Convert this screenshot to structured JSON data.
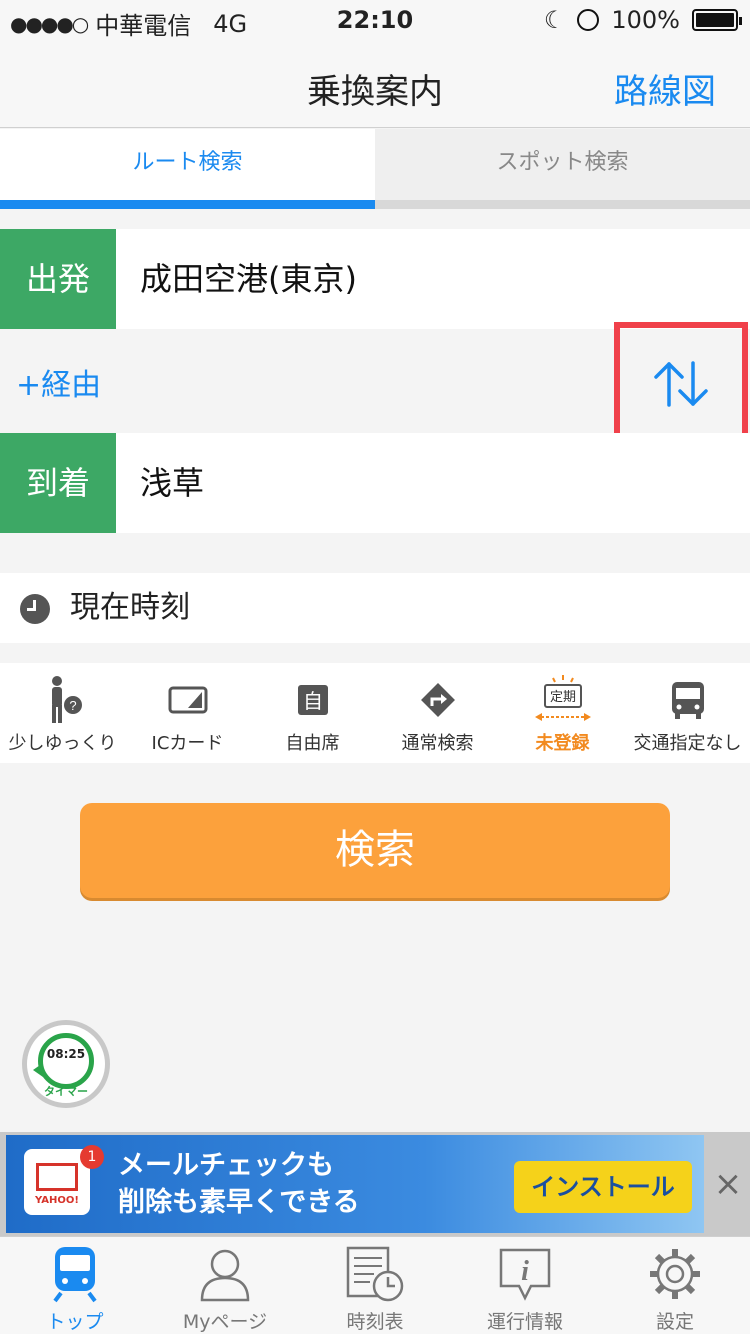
{
  "status_bar": {
    "signal": "●●●●○",
    "carrier": "中華電信",
    "network": "4G",
    "time": "22:10",
    "battery": "100%"
  },
  "nav": {
    "title": "乗換案内",
    "route_map": "路線図"
  },
  "tabs": [
    {
      "label": "ルート検索",
      "active": true
    },
    {
      "label": "スポット検索",
      "active": false
    }
  ],
  "departure": {
    "badge": "出発",
    "station": "成田空港(東京)"
  },
  "via": {
    "label": "+経由"
  },
  "arrival": {
    "badge": "到着",
    "station": "浅草"
  },
  "time": {
    "label": "現在時刻"
  },
  "options": [
    {
      "label": "少しゆっくり",
      "icon": "walking-person-icon"
    },
    {
      "label": "ICカード",
      "icon": "ic-card-icon"
    },
    {
      "label": "自由席",
      "icon": "seat-icon"
    },
    {
      "label": "通常検索",
      "icon": "route-direction-icon"
    },
    {
      "label": "未登録",
      "icon": "commuter-pass-icon",
      "icon_text": "定期"
    },
    {
      "label": "交通指定なし",
      "icon": "bus-icon"
    }
  ],
  "search_button": {
    "label": "検索"
  },
  "timer": {
    "time": "08:25",
    "label": "タイマー"
  },
  "ad": {
    "brand": "YAHOO!",
    "badge_count": "1",
    "line1": "メールチェックも",
    "line2": "削除も素早くできる",
    "install": "インストール",
    "close": "×"
  },
  "tabbar": [
    {
      "label": "トップ",
      "icon": "train-icon",
      "active": true
    },
    {
      "label": "Myページ",
      "icon": "person-icon",
      "active": false
    },
    {
      "label": "時刻表",
      "icon": "timetable-icon",
      "active": false
    },
    {
      "label": "運行情報",
      "icon": "info-icon",
      "active": false
    },
    {
      "label": "設定",
      "icon": "gear-icon",
      "active": false
    }
  ],
  "colors": {
    "accent": "#1a8af0",
    "green": "#3da865",
    "orange": "#fca13c",
    "highlight": "#f0404a"
  }
}
